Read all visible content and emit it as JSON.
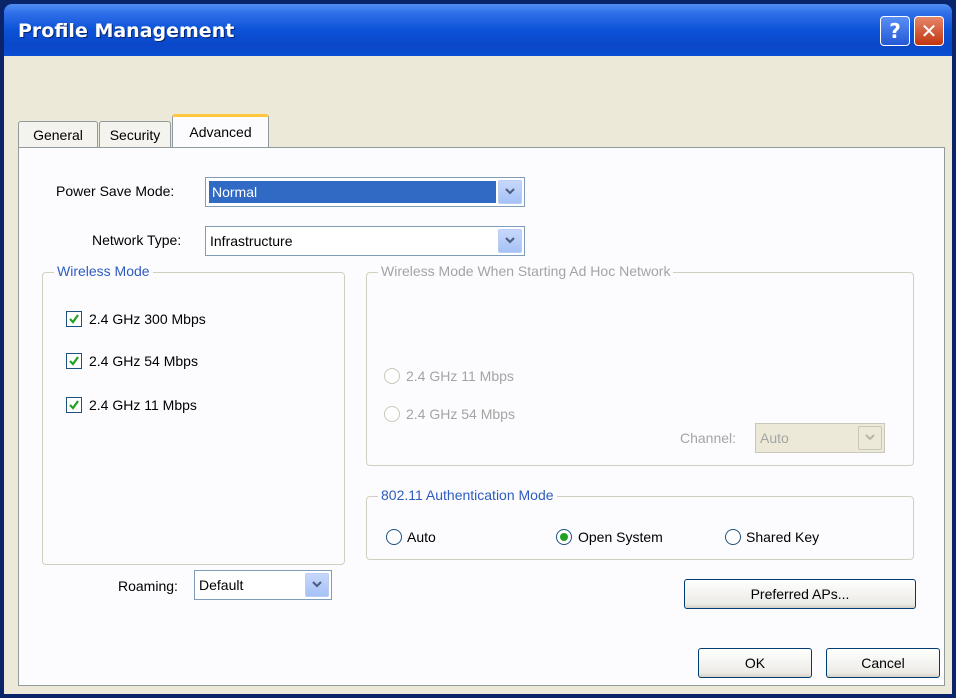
{
  "window": {
    "title": "Profile Management"
  },
  "tabs": [
    {
      "label": "General"
    },
    {
      "label": "Security"
    },
    {
      "label": "Advanced"
    }
  ],
  "power_save": {
    "label": "Power Save Mode:",
    "value": "Normal"
  },
  "network_type": {
    "label": "Network Type:",
    "value": "Infrastructure"
  },
  "wireless_mode": {
    "title": "Wireless Mode",
    "options": [
      {
        "label": "2.4 GHz 300 Mbps",
        "checked": true
      },
      {
        "label": "2.4 GHz 54 Mbps",
        "checked": true
      },
      {
        "label": "2.4 GHz 11 Mbps",
        "checked": true
      }
    ]
  },
  "adhoc": {
    "title": "Wireless Mode When Starting Ad Hoc Network",
    "options": [
      {
        "label": "2.4 GHz 11 Mbps"
      },
      {
        "label": "2.4 GHz 54 Mbps"
      }
    ],
    "channel_label": "Channel:",
    "channel_value": "Auto"
  },
  "auth": {
    "title": "802.11 Authentication Mode",
    "options": [
      {
        "label": "Auto",
        "selected": false
      },
      {
        "label": "Open System",
        "selected": true
      },
      {
        "label": "Shared Key",
        "selected": false
      }
    ]
  },
  "roaming": {
    "label": "Roaming:",
    "value": "Default"
  },
  "buttons": {
    "preferred_aps": "Preferred APs...",
    "ok": "OK",
    "cancel": "Cancel"
  },
  "colors": {
    "accent": "#316ac5",
    "group_title": "#2e5bbf",
    "titlebar": "#0b52d8",
    "check": "#21a121"
  }
}
